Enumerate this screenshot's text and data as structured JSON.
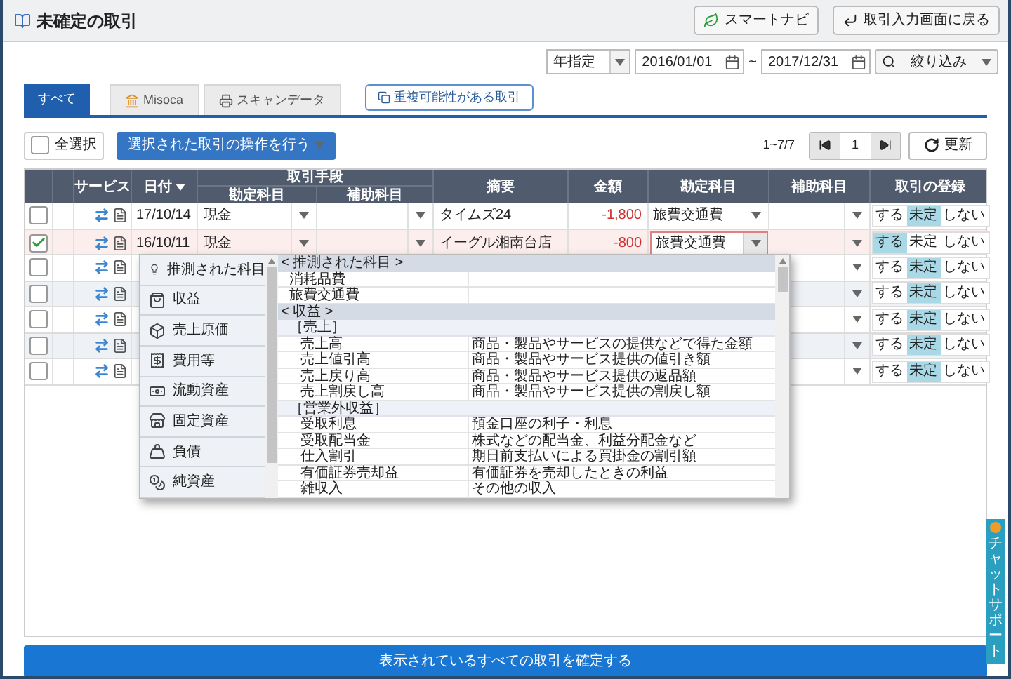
{
  "header": {
    "title": "未確定の取引",
    "buttons": [
      {
        "label": "スマートナビ",
        "kind": "navi"
      },
      {
        "label": "取引入力画面に戻る",
        "kind": "back"
      }
    ]
  },
  "filter": {
    "period": "年指定",
    "date_from": "2016/01/01",
    "separator": "~",
    "date_to": "2017/12/31",
    "filter_button": "絞り込み"
  },
  "tabs": [
    {
      "label": "すべて",
      "selected": true,
      "kind": "plain"
    },
    {
      "label": "Misoca",
      "selected": false,
      "kind": "bank"
    },
    {
      "label": "スキャンデータ",
      "selected": false,
      "kind": "print"
    }
  ],
  "duplicate_button": "重複可能性がある取引",
  "toolbar": {
    "select_all": {
      "label": "全選択",
      "checked": false
    },
    "action_button": "選択された取引の操作を行う",
    "range": "1~7/7",
    "page": "1",
    "refresh": "更新"
  },
  "table": {
    "columns": {
      "service": "サービス",
      "date": "日付",
      "method": "取引手段",
      "method_account": "勘定科目",
      "method_sub": "補助科目",
      "description": "摘要",
      "amount": "金額",
      "account": "勘定科目",
      "sub_account": "補助科目",
      "registration": "取引の登録"
    },
    "rows": [
      {
        "checked": false,
        "date": "17/10/14",
        "method_account": "現金",
        "description": "タイムズ24",
        "amount": "-1,800",
        "account": "旅費交通費",
        "editing": false,
        "registration": [
          {
            "label": "する",
            "selected": false
          },
          {
            "label": "未定",
            "selected": true
          },
          {
            "label": "しない",
            "selected": false
          }
        ]
      },
      {
        "checked": true,
        "date": "16/10/11",
        "method_account": "現金",
        "description": "イーグル湘南台店",
        "amount": "-800",
        "account": "旅費交通費",
        "editing": true,
        "registration": [
          {
            "label": "する",
            "selected": true
          },
          {
            "label": "未定",
            "selected": false
          },
          {
            "label": "しない",
            "selected": false
          }
        ]
      },
      {
        "checked": false,
        "registration": [
          {
            "label": "する",
            "selected": false
          },
          {
            "label": "未定",
            "selected": true
          },
          {
            "label": "しない",
            "selected": false
          }
        ]
      },
      {
        "checked": false,
        "registration": [
          {
            "label": "する",
            "selected": false
          },
          {
            "label": "未定",
            "selected": true
          },
          {
            "label": "しない",
            "selected": false
          }
        ]
      },
      {
        "checked": false,
        "registration": [
          {
            "label": "する",
            "selected": false
          },
          {
            "label": "未定",
            "selected": true
          },
          {
            "label": "しない",
            "selected": false
          }
        ]
      },
      {
        "checked": false,
        "registration": [
          {
            "label": "する",
            "selected": false
          },
          {
            "label": "未定",
            "selected": true
          },
          {
            "label": "しない",
            "selected": false
          }
        ]
      },
      {
        "checked": false,
        "registration": [
          {
            "label": "する",
            "selected": false
          },
          {
            "label": "未定",
            "selected": true
          },
          {
            "label": "しない",
            "selected": false
          }
        ]
      }
    ]
  },
  "dropdown": {
    "categories": [
      {
        "label": "推測された科目"
      },
      {
        "label": "収益"
      },
      {
        "label": "売上原価"
      },
      {
        "label": "費用等"
      },
      {
        "label": "流動資産"
      },
      {
        "label": "固定資産"
      },
      {
        "label": "負債"
      },
      {
        "label": "純資産"
      }
    ],
    "groups": [
      {
        "label": "< 推測された科目 >",
        "children": [
          {
            "name": "消耗品費"
          },
          {
            "name": "旅費交通費"
          }
        ]
      },
      {
        "label": "< 収益 >",
        "children": [
          {
            "label": "［売上］",
            "children": [
              {
                "name": "売上高",
                "note": "商品・製品やサービスの提供などで得た金額"
              },
              {
                "name": "売上値引高",
                "note": "商品・製品やサービス提供の値引き額"
              },
              {
                "name": "売上戻り高",
                "note": "商品・製品やサービス提供の返品額"
              },
              {
                "name": "売上割戻し高",
                "note": "商品・製品やサービス提供の割戻し額"
              }
            ]
          },
          {
            "label": "［営業外収益］",
            "children": [
              {
                "name": "受取利息",
                "note": "預金口座の利子・利息"
              },
              {
                "name": "受取配当金",
                "note": "株式などの配当金、利益分配金など"
              },
              {
                "name": "仕入割引",
                "note": "期日前支払いによる買掛金の割引額"
              },
              {
                "name": "有価証券売却益",
                "note": "有価証券を売却したときの利益"
              },
              {
                "name": "雑収入",
                "note": "その他の収入"
              }
            ]
          }
        ]
      }
    ]
  },
  "confirm_button": "表示されているすべての取引を確定する",
  "chat_support": "チャットサポート"
}
